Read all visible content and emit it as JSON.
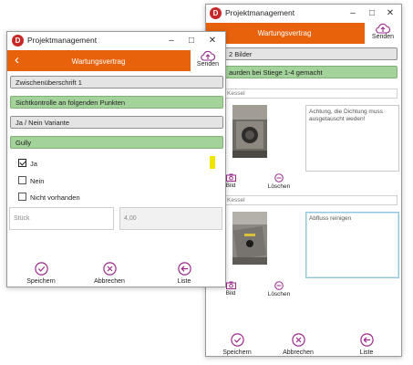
{
  "colors": {
    "accent": "#e8620c",
    "green_bar": "#a3d39a",
    "action_purple": "#9c2a8c",
    "highlight": "#f1e600",
    "app_icon_red": "#c62828"
  },
  "back_window": {
    "title": "Projektmanagement",
    "app_icon_letter": "D",
    "header_title": "Wartungsvertrag",
    "send_label": "Senden",
    "count_label": "2 Bilder",
    "green_label": "aurden bei Stiege 1-4 gemacht",
    "photo_groups": [
      {
        "input_value": "Kessel",
        "notes_text": "Achtung, die Dichtung muss ausgetauscht weden!",
        "image_button": "Bild",
        "delete_button": "Löschen",
        "photo_icon": "boiler-photo"
      },
      {
        "input_value": "Kessel",
        "notes_text": "Abfluss reinigen",
        "image_button": "Bild",
        "delete_button": "Löschen",
        "photo_icon": "drain-photo"
      }
    ],
    "actions": {
      "save": "Speichern",
      "cancel": "Abbrechen",
      "list": "Liste"
    }
  },
  "front_window": {
    "title": "Projektmanagement",
    "app_icon_letter": "D",
    "header_title": "Wartungsvertrag",
    "send_label": "Senden",
    "sections": [
      "Zwischenüberschrift 1",
      "Sichtkontrolle an folgenden Punkten",
      "Ja / Nein Variante",
      "Gully"
    ],
    "options": [
      {
        "label": "Ja",
        "checked": true
      },
      {
        "label": "Nein",
        "checked": false
      },
      {
        "label": "Nicht vorhanden",
        "checked": false
      }
    ],
    "unit_placeholder": "Stück",
    "quantity_value": "4,00",
    "actions": {
      "save": "Speichern",
      "cancel": "Abbrechen",
      "list": "Liste"
    }
  }
}
